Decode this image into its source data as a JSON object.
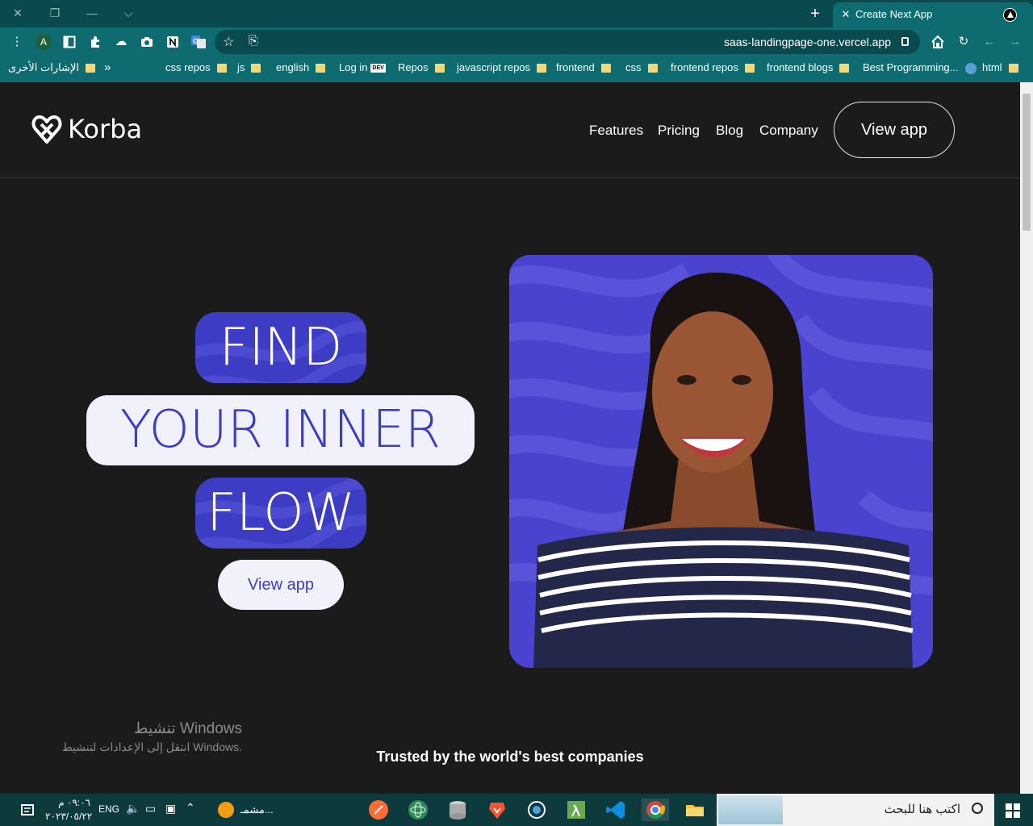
{
  "browser": {
    "tab_title": "Create Next App",
    "url": "saas-landingpage-one.vercel.app",
    "profile_initial": "A",
    "bookmarks": [
      "html",
      "Best Programming...",
      "frontend blogs",
      "frontend repos",
      "css",
      "frontend",
      "javascript repos",
      "Repos",
      "Log in",
      "english",
      "js",
      "css repos",
      "»",
      "الإشارات الأخرى"
    ],
    "dev_badge": "DEV"
  },
  "site": {
    "logo_text": "Korba",
    "nav": [
      "Features",
      "Pricing",
      "Blog",
      "Company"
    ],
    "nav_cta": "View app",
    "hero": {
      "line1": "FIND",
      "line2": "YOUR INNER",
      "line3": "FLOW",
      "cta": "View app"
    },
    "trusted": "Trusted by the world's best companies",
    "brand_color": "#3d3cc4"
  },
  "os": {
    "activation_title": "تنشيط Windows",
    "activation_sub": "انتقل إلى الإعدادات لتنشيط Windows.",
    "search_placeholder": "اكتب هنا للبحث",
    "time": "٠٩:٠٦ م",
    "date": "٢٠٢٣/٠٥/٢٢",
    "lang": "ENG",
    "taskbar_app_label": "مشمـ..."
  }
}
